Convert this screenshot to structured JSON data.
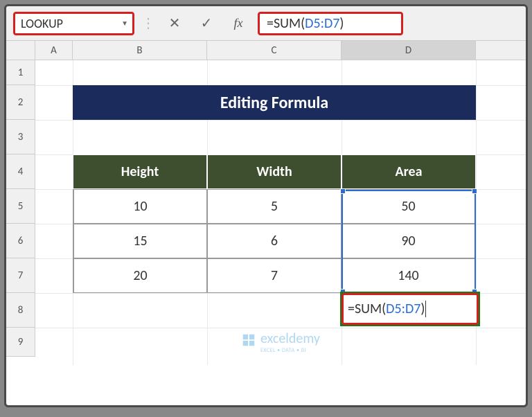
{
  "formula_bar": {
    "name_box": "LOOKUP",
    "cancel_glyph": "✕",
    "enter_glyph": "✓",
    "fx_label": "fx",
    "formula_prefix": "=SUM(",
    "formula_ref": "D5:D7",
    "formula_suffix": ")"
  },
  "columns": {
    "a": "A",
    "b": "B",
    "c": "C",
    "d": "D"
  },
  "rows": {
    "r1": "1",
    "r2": "2",
    "r3": "3",
    "r4": "4",
    "r5": "5",
    "r6": "6",
    "r7": "7",
    "r8": "8",
    "r9": "9"
  },
  "title": "Editing Formula",
  "table": {
    "headers": {
      "b": "Height",
      "c": "Width",
      "d": "Area"
    },
    "data": [
      {
        "b": "10",
        "c": "5",
        "d": "50"
      },
      {
        "b": "15",
        "c": "6",
        "d": "90"
      },
      {
        "b": "20",
        "c": "7",
        "d": "140"
      }
    ]
  },
  "edit_cell": {
    "prefix": "=SUM(",
    "ref": "D5:D7",
    "suffix": ")"
  },
  "watermark": {
    "text": "exceldemy",
    "sub": "EXCEL • DATA • BI"
  },
  "colors": {
    "title_bg": "#1a2b5c",
    "header_bg": "#3d4f2f",
    "highlight_red": "#d62020",
    "selection_blue": "#2b6cd4",
    "green_box": "#1a7a1a"
  }
}
